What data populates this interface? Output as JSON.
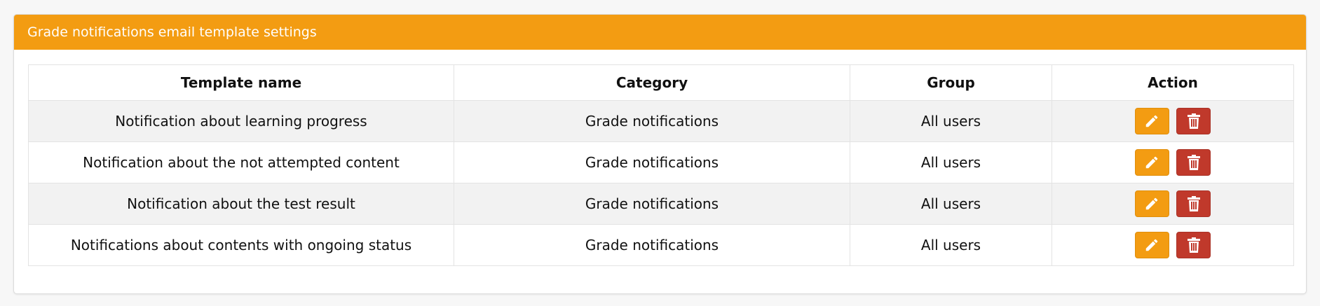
{
  "panel": {
    "title": "Grade notifications email template settings",
    "accent_color": "#f39c12",
    "danger_color": "#c0392b"
  },
  "table": {
    "headers": [
      "Template name",
      "Category",
      "Group",
      "Action"
    ],
    "rows": [
      {
        "name": "Notification about learning progress",
        "category": "Grade notifications",
        "group": "All users"
      },
      {
        "name": "Notification about the not attempted content",
        "category": "Grade notifications",
        "group": "All users"
      },
      {
        "name": "Notification about the test result",
        "category": "Grade notifications",
        "group": "All users"
      },
      {
        "name": "Notifications about contents with ongoing status",
        "category": "Grade notifications",
        "group": "All users"
      }
    ],
    "row_actions": [
      {
        "icon": "pencil-icon",
        "action": "edit"
      },
      {
        "icon": "trash-icon",
        "action": "delete"
      }
    ]
  }
}
